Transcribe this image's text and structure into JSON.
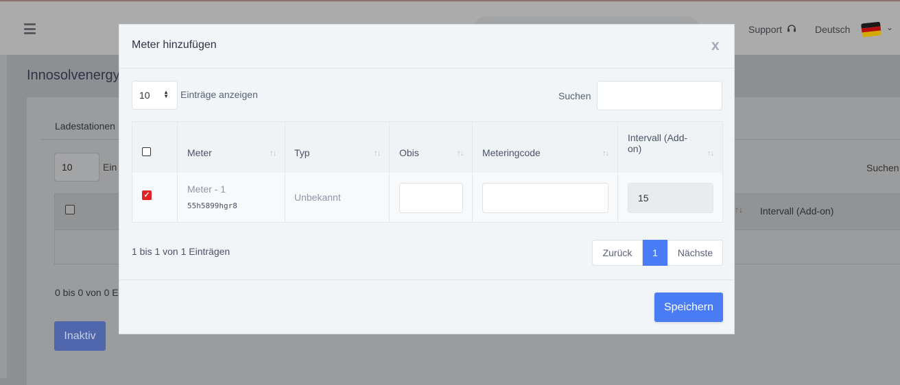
{
  "navbar": {
    "support_label": "Support",
    "language_label": "Deutsch",
    "flag_colors": [
      "#000000",
      "#dd0000",
      "#ffce00"
    ]
  },
  "background": {
    "page_title": "Innosolvenergy",
    "tab_label": "Ladestationen",
    "length_value": "10",
    "length_label": "Ein",
    "search_label": "Suchen",
    "column_last": "Intervall (Add-on)",
    "info_text": "0 bis 0 von 0 E",
    "inactive_button": "Inaktiv"
  },
  "modal": {
    "title": "Meter hinzufügen",
    "close_label": "x",
    "length_value": "10",
    "length_label": "Einträge anzeigen",
    "search_label": "Suchen",
    "search_value": "",
    "columns": {
      "meter": "Meter",
      "typ": "Typ",
      "obis": "Obis",
      "meteringcode": "Meteringcode",
      "intervall_line1": "Intervall (Add-",
      "intervall_line2": "on)"
    },
    "rows": [
      {
        "checked": true,
        "meter_name": "Meter - 1",
        "meter_id": "55h5899hgr8",
        "typ": "Unbekannt",
        "obis": "",
        "meteringcode": "",
        "intervall": "15"
      }
    ],
    "info_text": "1 bis 1 von 1 Einträgen",
    "pagination": {
      "prev": "Zurück",
      "current": "1",
      "next": "Nächste"
    },
    "save_button": "Speichern",
    "accent_color": "#4a7cf6"
  }
}
